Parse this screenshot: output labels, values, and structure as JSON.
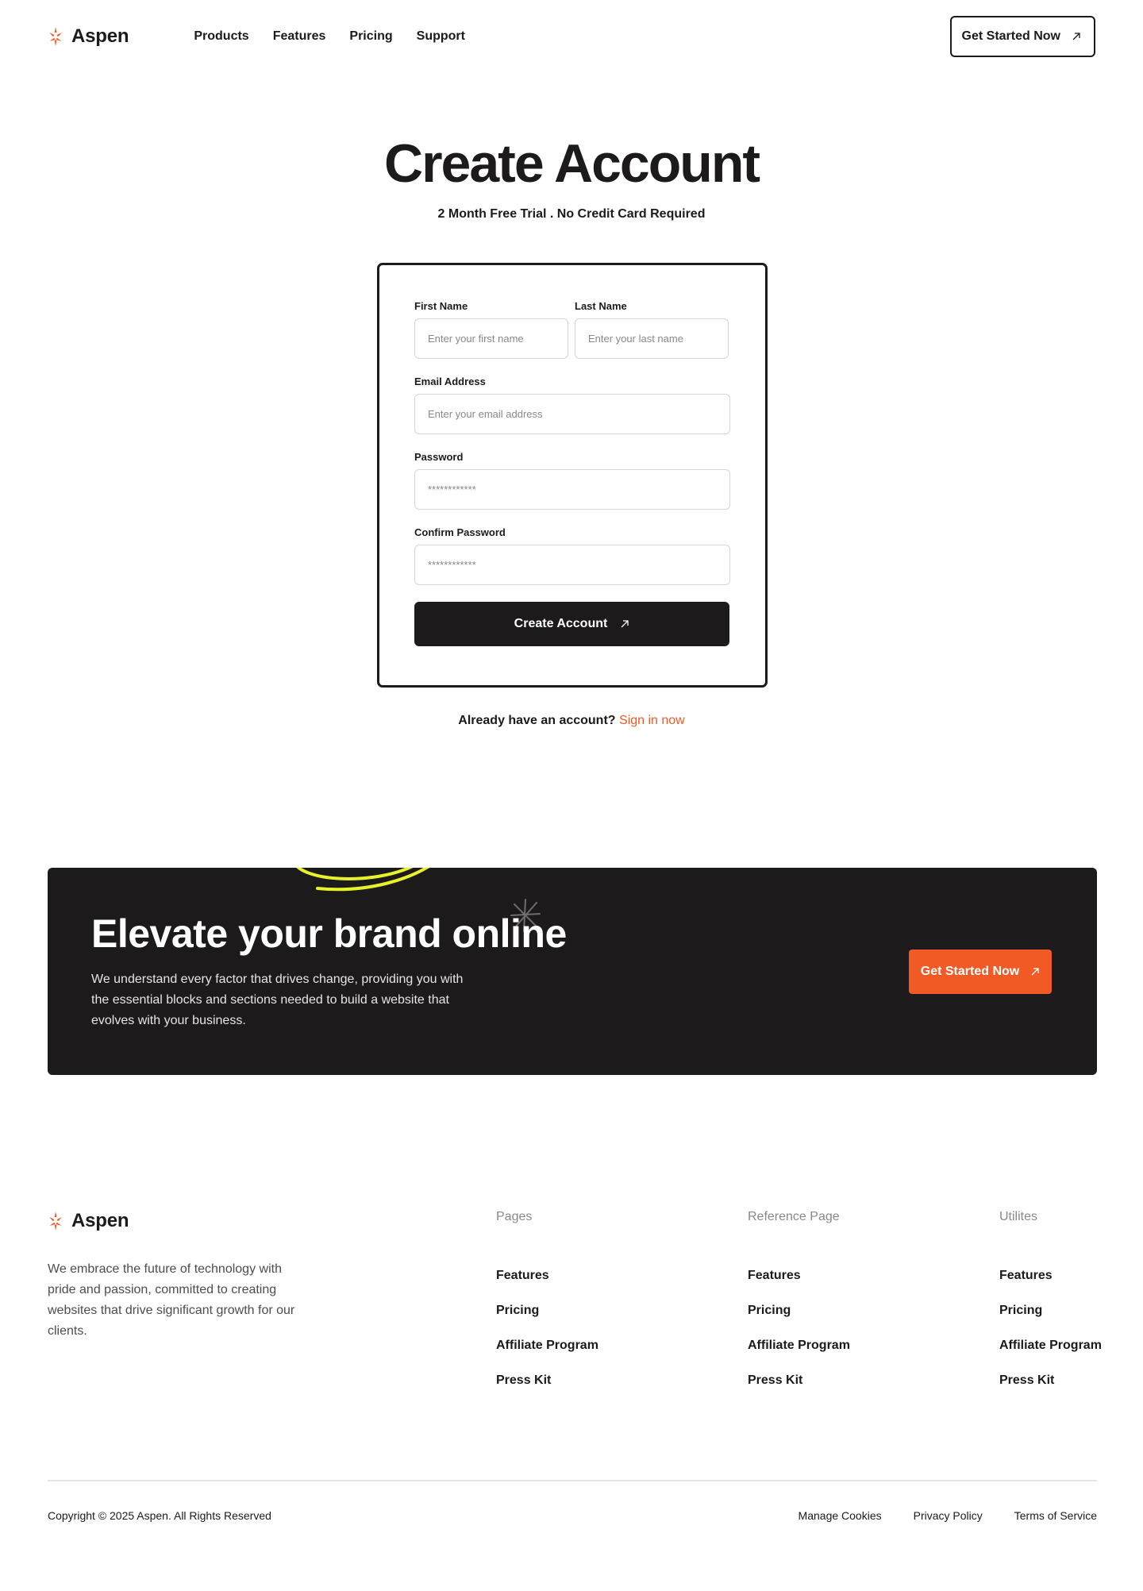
{
  "brand": {
    "name": "Aspen",
    "accent": "#f15a24",
    "dark": "#1c1a1b"
  },
  "nav": {
    "items": [
      "Products",
      "Features",
      "Pricing",
      "Support"
    ],
    "cta": "Get Started Now"
  },
  "hero": {
    "title": "Create Account",
    "subtitle": "2 Month Free Trial . No Credit Card Required"
  },
  "form": {
    "first_name": {
      "label": "First Name",
      "placeholder": "Enter your first name"
    },
    "last_name": {
      "label": "Last Name",
      "placeholder": "Enter your last name"
    },
    "email": {
      "label": "Email Address",
      "placeholder": "Enter your email address"
    },
    "password": {
      "label": "Password",
      "placeholder": "************"
    },
    "confirm_password": {
      "label": "Confirm Password",
      "placeholder": "************"
    },
    "submit": "Create Account"
  },
  "signin": {
    "prompt": "Already have an account?",
    "link": "Sign in now"
  },
  "banner": {
    "title": "Elevate your brand online",
    "text": "We understand every factor that drives change, providing you with the essential blocks and sections needed to build a website that evolves with your business.",
    "cta": "Get Started Now",
    "highlight_color": "#e8f22b"
  },
  "footer": {
    "description": "We embrace the future of technology with pride and passion, committed to creating websites that drive significant growth for our clients.",
    "columns": [
      {
        "title": "Pages",
        "links": [
          "Features",
          "Pricing",
          "Affiliate Program",
          "Press Kit"
        ]
      },
      {
        "title": "Reference Page",
        "links": [
          "Features",
          "Pricing",
          "Affiliate Program",
          "Press Kit"
        ]
      },
      {
        "title": "Utilites",
        "links": [
          "Features",
          "Pricing",
          "Affiliate Program",
          "Press Kit"
        ]
      }
    ],
    "copyright": "Copyright © 2025 Aspen. All Rights Reserved",
    "legal": [
      "Manage Cookies",
      "Privacy Policy",
      "Terms of Service"
    ]
  }
}
